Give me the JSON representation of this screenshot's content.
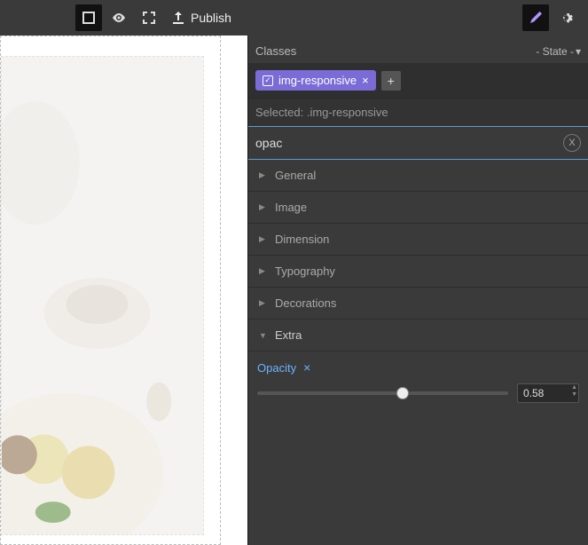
{
  "toolbar": {
    "publish_label": "Publish"
  },
  "panel": {
    "classes_label": "Classes",
    "state_label": "- State -",
    "active_class": "img-responsive",
    "selected_prefix": "Selected:",
    "selected_value": ".img-responsive",
    "search_value": "opac",
    "search_clear": "X"
  },
  "sectors": {
    "general": "General",
    "image": "Image",
    "dimension": "Dimension",
    "typography": "Typography",
    "decorations": "Decorations",
    "extra": "Extra"
  },
  "opacity": {
    "label": "Opacity",
    "value": "0.58",
    "percent": 58
  }
}
